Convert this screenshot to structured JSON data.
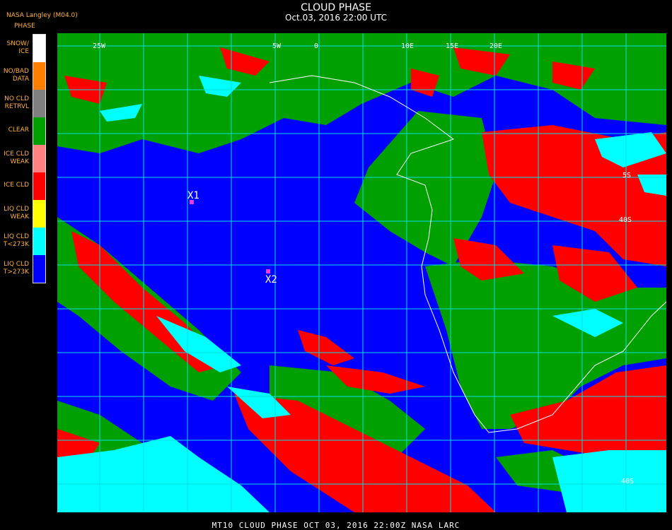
{
  "header": {
    "title": "CLOUD PHASE",
    "subtitle": "Oct.03, 2016 22:00 UTC",
    "producer": "NASA Langley (M04.0)"
  },
  "legend": {
    "title": "PHASE",
    "items": [
      {
        "label": "SNOW/\nICE",
        "color": "#ffffff"
      },
      {
        "label": "NO/BAD\nDATA",
        "color": "#ff8000"
      },
      {
        "label": "NO CLD\nRETRVL",
        "color": "#808080"
      },
      {
        "label": "CLEAR",
        "color": "#00a000"
      },
      {
        "label": "ICE CLD\nWEAK",
        "color": "#ff8080"
      },
      {
        "label": "ICE CLD",
        "color": "#ff0000"
      },
      {
        "label": "LIQ CLD\nWEAK",
        "color": "#ffff00"
      },
      {
        "label": "LIQ CLD\nT<273K",
        "color": "#00ffff"
      },
      {
        "label": "LIQ CLD\nT>273K",
        "color": "#0000ff"
      }
    ]
  },
  "map": {
    "grid_color": "#00e0e0",
    "coast_color": "#ffffff",
    "markers": [
      {
        "label": "X1",
        "color": "#e040e0"
      },
      {
        "label": "X2",
        "color": "#e040e0"
      }
    ],
    "lon_labels": [
      "25W",
      "5W",
      "0",
      "10E",
      "15E",
      "20E"
    ],
    "lat_labels": [
      "5S",
      "40S",
      "40S"
    ]
  },
  "footer": "MT10  CLOUD PHASE   OCT 03, 2016 22:00Z   NASA LARC"
}
